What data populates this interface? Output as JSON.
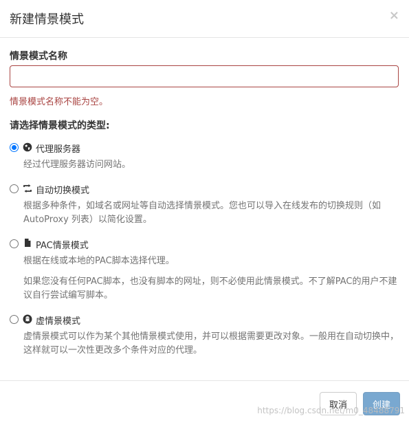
{
  "dialog": {
    "title": "新建情景模式",
    "close_symbol": "×"
  },
  "name_field": {
    "label": "情景模式名称",
    "value": "",
    "placeholder": "",
    "error": "情景模式名称不能为空。"
  },
  "type_section": {
    "label": "请选择情景模式的类型:",
    "options": [
      {
        "label": "代理服务器",
        "icon": "globe-icon",
        "checked": true,
        "help": [
          "经过代理服务器访问网站。"
        ]
      },
      {
        "label": "自动切换模式",
        "icon": "retweet-icon",
        "checked": false,
        "help": [
          "根据多种条件，如域名或网址等自动选择情景模式。您也可以导入在线发布的切换规则（如 AutoProxy 列表）以简化设置。"
        ]
      },
      {
        "label": "PAC情景模式",
        "icon": "file-icon",
        "checked": false,
        "help": [
          "根据在线或本地的PAC脚本选择代理。",
          "如果您没有任何PAC脚本，也没有脚本的网址，则不必使用此情景模式。不了解PAC的用户不建议自行尝试编写脚本。"
        ]
      },
      {
        "label": "虚情景模式",
        "icon": "ghost-icon",
        "checked": false,
        "help": [
          "虚情景模式可以作为某个其他情景模式使用，并可以根据需要更改对象。一般用在自动切换中，这样就可以一次性更改多个条件对应的代理。"
        ]
      }
    ]
  },
  "footer": {
    "cancel_label": "取消",
    "create_label": "创建"
  },
  "watermark": "https://blog.csdn.net/m0_48488791"
}
